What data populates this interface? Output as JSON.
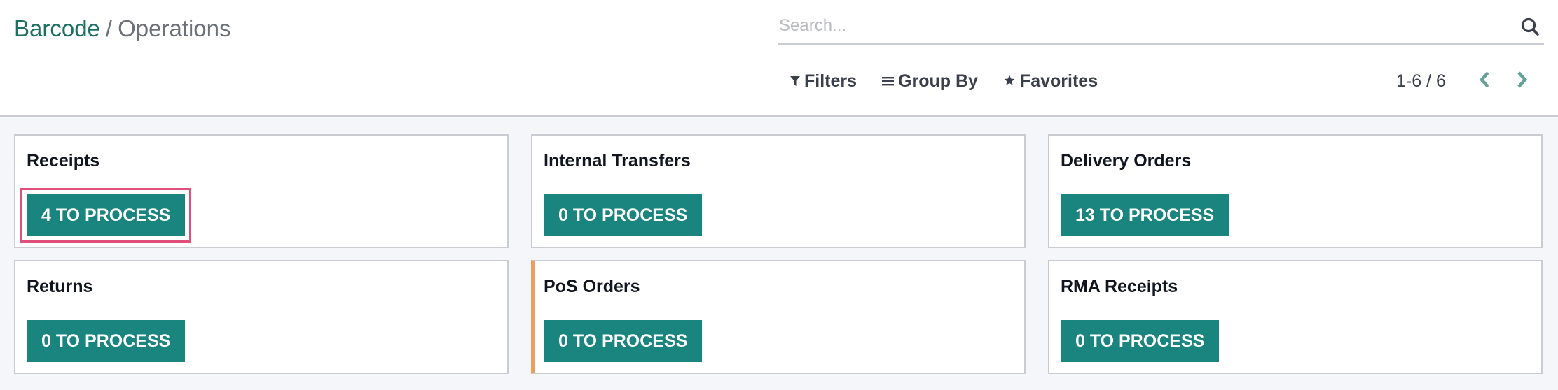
{
  "breadcrumb": {
    "root": "Barcode",
    "separator": "/",
    "current": "Operations"
  },
  "search": {
    "placeholder": "Search...",
    "value": "",
    "icon": "search-icon"
  },
  "toolbar": {
    "filters_label": "Filters",
    "filters_icon": "filter-icon",
    "group_by_label": "Group By",
    "group_by_icon": "list-icon",
    "favorites_label": "Favorites",
    "favorites_icon": "star-icon"
  },
  "pager": {
    "value": "1-6 / 6",
    "prev_icon": "chevron-left-icon",
    "next_icon": "chevron-right-icon"
  },
  "colors": {
    "brand": "#1d6f64",
    "button": "#1a847e",
    "accent_border": "#ee9d5a",
    "highlight": "#e0507a"
  },
  "operations": [
    {
      "title": "Receipts",
      "button_label": "4 TO PROCESS",
      "count": 4,
      "highlighted": true
    },
    {
      "title": "Internal Transfers",
      "button_label": "0 TO PROCESS",
      "count": 0
    },
    {
      "title": "Delivery Orders",
      "button_label": "13 TO PROCESS",
      "count": 13
    },
    {
      "title": "Returns",
      "button_label": "0 TO PROCESS",
      "count": 0
    },
    {
      "title": "PoS Orders",
      "button_label": "0 TO PROCESS",
      "count": 0,
      "accent": true
    },
    {
      "title": "RMA Receipts",
      "button_label": "0 TO PROCESS",
      "count": 0
    }
  ]
}
